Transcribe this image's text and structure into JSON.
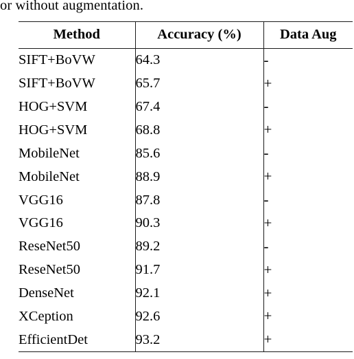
{
  "document": {
    "caption_tail": "or without augmentation."
  },
  "table": {
    "name": "classification-results-table",
    "columns": [
      {
        "key": "method",
        "label": "Method"
      },
      {
        "key": "accuracy",
        "label": "Accuracy (%)"
      },
      {
        "key": "data_aug",
        "label": "Data Aug"
      }
    ],
    "rows": [
      {
        "method": "SIFT+BoVW",
        "accuracy": "64.3",
        "data_aug": "-"
      },
      {
        "method": "SIFT+BoVW",
        "accuracy": "65.7",
        "data_aug": "+"
      },
      {
        "method": "HOG+SVM",
        "accuracy": "67.4",
        "data_aug": "-"
      },
      {
        "method": "HOG+SVM",
        "accuracy": "68.8",
        "data_aug": "+"
      },
      {
        "method": "MobileNet",
        "accuracy": "85.6",
        "data_aug": "-"
      },
      {
        "method": "MobileNet",
        "accuracy": "88.9",
        "data_aug": "+"
      },
      {
        "method": "VGG16",
        "accuracy": "87.8",
        "data_aug": "-"
      },
      {
        "method": "VGG16",
        "accuracy": "90.3",
        "data_aug": "+"
      },
      {
        "method": "ReseNet50",
        "accuracy": "89.2",
        "data_aug": "-"
      },
      {
        "method": "ReseNet50",
        "accuracy": "91.7",
        "data_aug": "+"
      },
      {
        "method": "DenseNet",
        "accuracy": "92.1",
        "data_aug": "+"
      },
      {
        "method": "XCeption",
        "accuracy": "92.6",
        "data_aug": "+"
      },
      {
        "method": "EfficientDet",
        "accuracy": "93.2",
        "data_aug": "+"
      }
    ]
  },
  "style": {
    "text_color": "#000000",
    "rule_color": "#1a1a1a",
    "page_background": "#ffffff"
  }
}
